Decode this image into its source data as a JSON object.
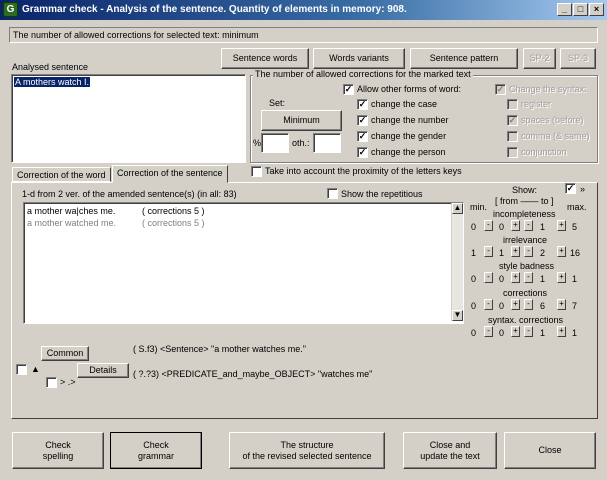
{
  "window": {
    "title": "Grammar check - Analysis of the sentence. Quantity of elements in memory: 908.",
    "minimize": "_",
    "restore": "□",
    "close": "×"
  },
  "info_line": "The number of allowed corrections for selected text: minimum",
  "top_buttons": {
    "sentence_words": "Sentence words",
    "words_variants": "Words variants",
    "sentence_pattern": "Sentence pattern",
    "sp2": "SP-2",
    "sp3": "SP-3"
  },
  "analysed": {
    "label": "Analysed sentence",
    "sentence": "A mothers watch I."
  },
  "corrections_group": {
    "title": "The number of allowed corrections for the marked text",
    "set_label": "Set:",
    "minimum_button": "Minimum",
    "percent_label": "%",
    "oth_label": "oth.:",
    "allow_forms": "Allow other forms of word:",
    "options": [
      "change the case",
      "change the number",
      "change the gender",
      "change the person"
    ],
    "syntax_title": "Change the syntax:",
    "syntax_options": [
      "register",
      "spaces (before)",
      "comma (& same)",
      "conjunction"
    ]
  },
  "tabs": {
    "word": "Correction of the word",
    "sentence": "Correction of the sentence"
  },
  "proximity": "Take into account the proximity of the letters keys",
  "variants_header": "1-d from 2 ver. of the amended sentence(s) (in all: 83)",
  "show_repetitious": "Show the repetitious",
  "results": [
    {
      "text": "a mother wa|ches me.",
      "info": "( corrections 5 )"
    },
    {
      "text": "a mother watched me.",
      "info": "( corrections 5 )"
    }
  ],
  "stats": {
    "show_label": "Show:",
    "show_mark": "»",
    "min_label": "min.",
    "max_label": "max.",
    "range_label": "[ from —— to ]",
    "rows": [
      {
        "name": "incompleteness",
        "min": "0",
        "from": "0",
        "to": "1",
        "max": "5"
      },
      {
        "name": "irrelevance",
        "min": "1",
        "from": "1",
        "to": "2",
        "max": "16"
      },
      {
        "name": "style badness",
        "min": "0",
        "from": "0",
        "to": "1",
        "max": "1"
      },
      {
        "name": "corrections",
        "min": "0",
        "from": "0",
        "to": "6",
        "max": "7"
      },
      {
        "name": "syntax. corrections",
        "min": "0",
        "from": "0",
        "to": "1",
        "max": "1"
      }
    ]
  },
  "structure": {
    "common_button": "Common",
    "details_button": "Details",
    "arrow_label": "▲",
    "small_check_label": "> .>",
    "line1": "( S.f3)  <Sentence> \"a mother watches me.\"",
    "line2": "( ?.?3)  <PREDICATE_and_maybe_OBJECT> \"watches me\""
  },
  "bottom_buttons": {
    "check_spelling": "Check\nspelling",
    "check_grammar": "Check\ngrammar",
    "structure": "The structure\nof the revised selected sentence",
    "close_update": "Close and\nupdate the text",
    "close": "Close"
  }
}
